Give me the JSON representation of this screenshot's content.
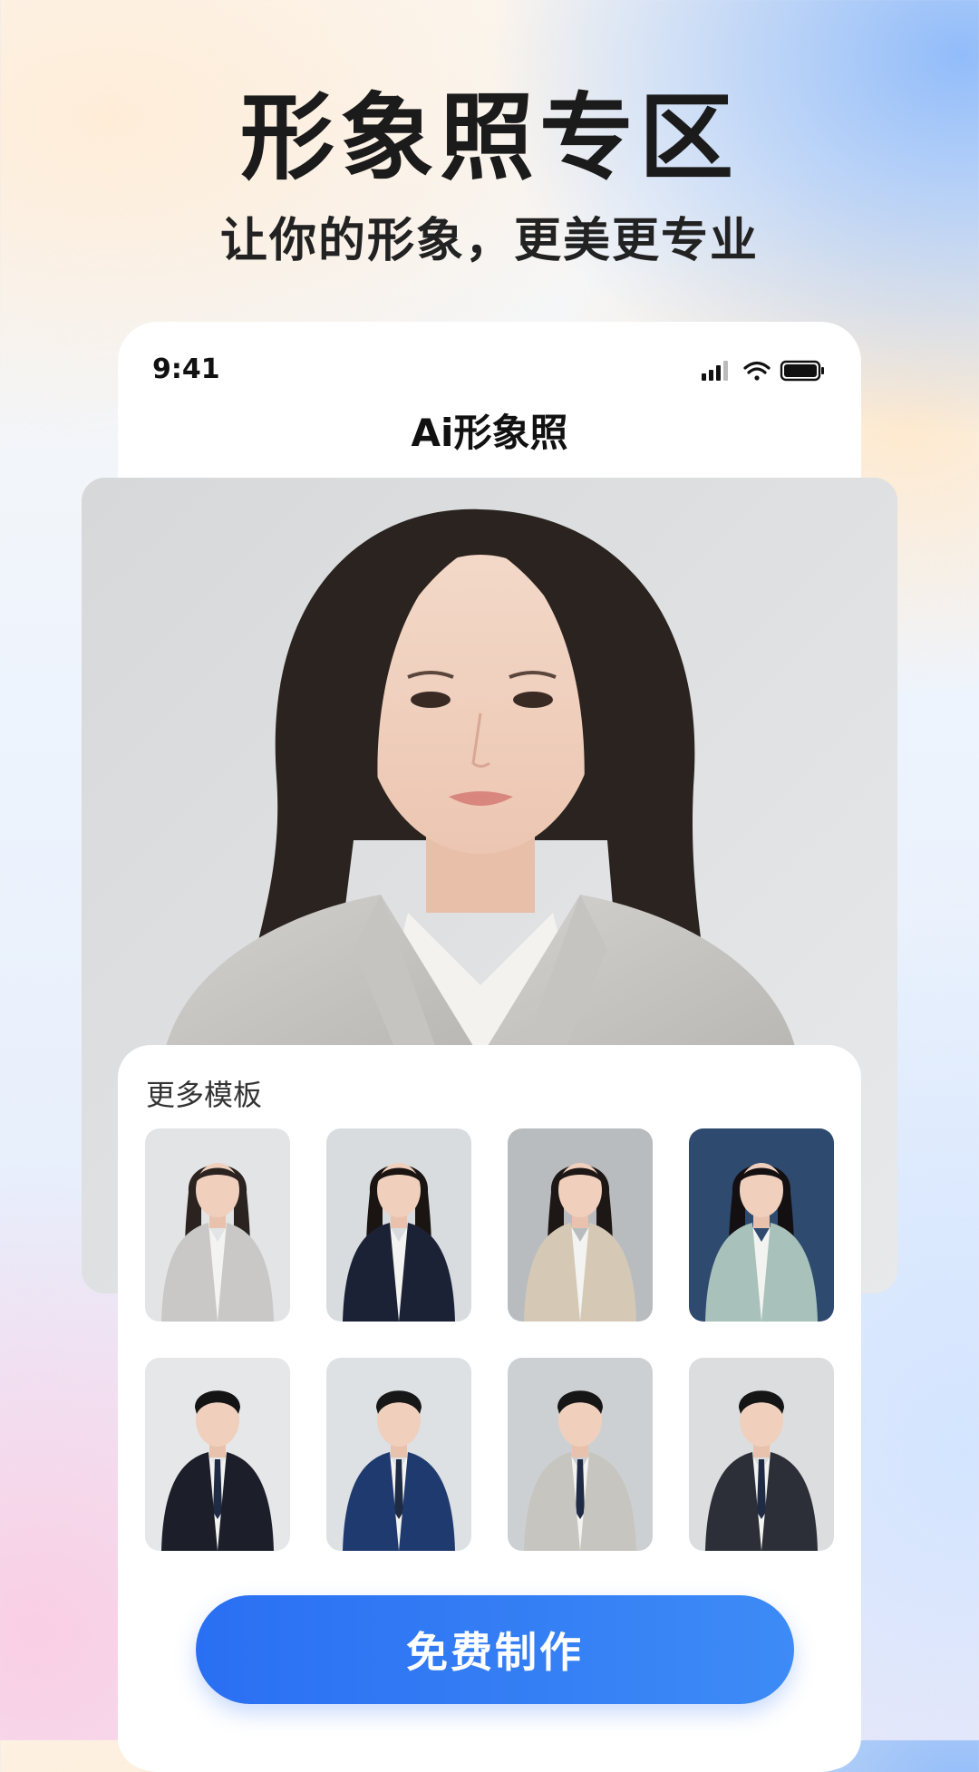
{
  "hero": {
    "title": "形象照专区",
    "subtitle": "让你的形象，更美更专业"
  },
  "status_bar": {
    "time": "9:41",
    "icons": [
      "signal-icon",
      "wifi-icon",
      "battery-icon"
    ]
  },
  "nav": {
    "title": "Ai形象照"
  },
  "main_photo": {
    "subject": "woman-in-grey-blazer"
  },
  "templates": {
    "title": "更多模板",
    "items": [
      {
        "subject": "woman-grey-blazer-arms-crossed",
        "bg": "#e3e4e5",
        "suit": "#c9c8c6",
        "hair": "#2a2320"
      },
      {
        "subject": "woman-navy-suit-arms-crossed",
        "bg": "#d9dcdf",
        "suit": "#1c2236",
        "hair": "#1a1412"
      },
      {
        "subject": "woman-beige-blazer",
        "bg": "#b9bcbf",
        "suit": "#d5c9b6",
        "hair": "#1d1715"
      },
      {
        "subject": "woman-teal-top-blue-bg",
        "bg": "#2e4a6e",
        "suit": "#a8c1bb",
        "hair": "#141012"
      },
      {
        "subject": "man-black-suit",
        "bg": "#e6e7e8",
        "suit": "#1c1f2a",
        "hair": "#141414"
      },
      {
        "subject": "man-navy-suit",
        "bg": "#dde1e4",
        "suit": "#1f3a6e",
        "hair": "#171717"
      },
      {
        "subject": "man-grey-three-piece-suit",
        "bg": "#cdd0d3",
        "suit": "#c7c5bf",
        "hair": "#161616"
      },
      {
        "subject": "man-charcoal-suit",
        "bg": "#dcdddf",
        "suit": "#2c2f37",
        "hair": "#151515"
      }
    ]
  },
  "cta": {
    "label": "免费制作"
  },
  "colors": {
    "accent": "#2a6ff3",
    "text": "#1b1b1b"
  }
}
